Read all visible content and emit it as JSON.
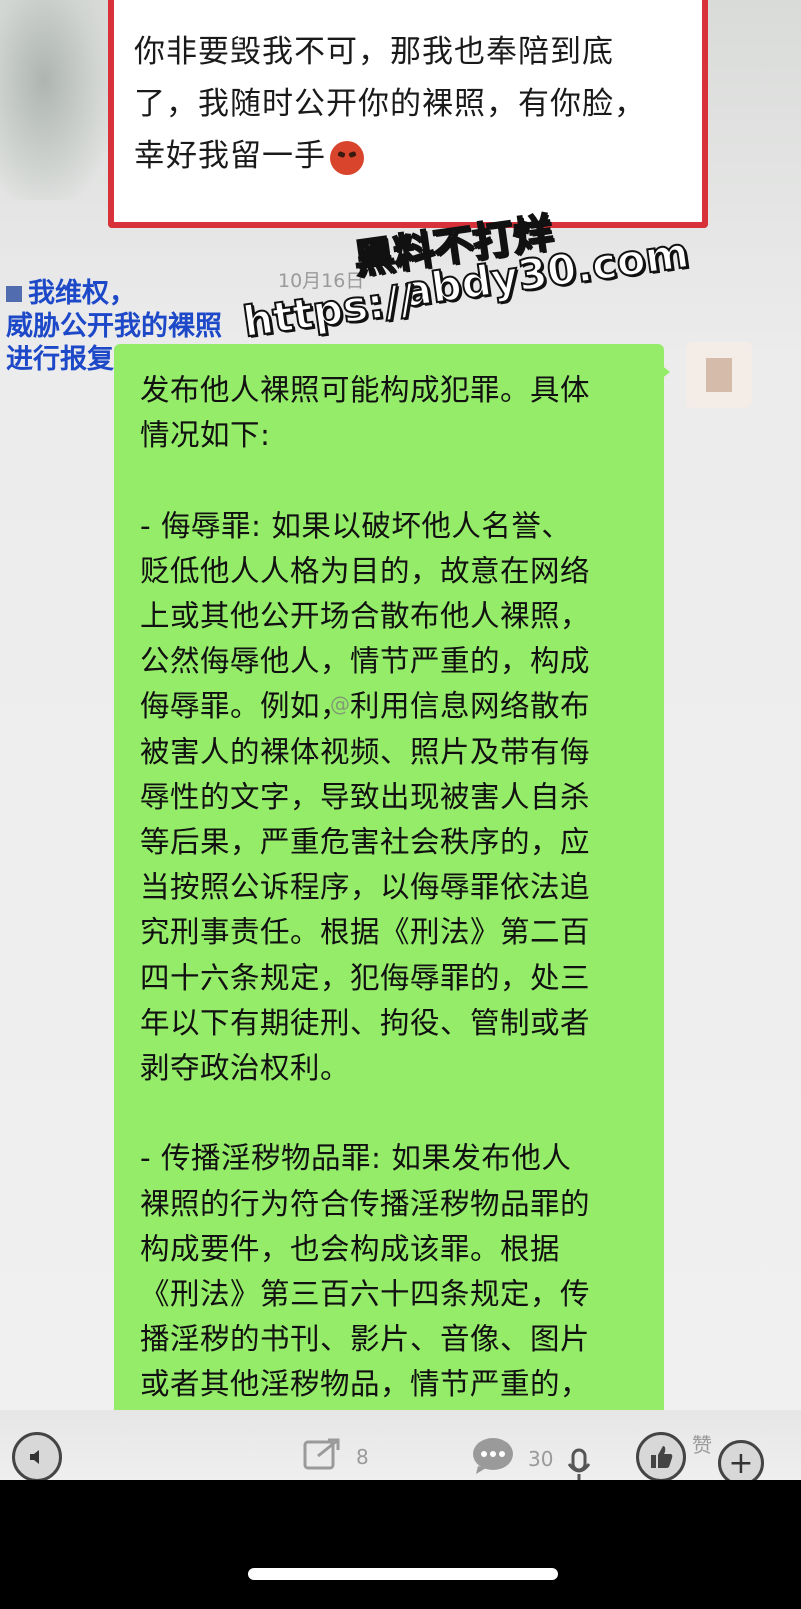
{
  "quoted_message": {
    "text": "你非要毁我不可，那我也奉陪到底了，我随时公开你的裸照，有你脸，幸好我留一手"
  },
  "caption": {
    "text": "我维权，\n威胁公开我的裸照\n进行报复"
  },
  "timestamp": "10月16日",
  "watermark": {
    "line1": "黑料不打烊",
    "line2": "abdy30.com",
    "line3": "https://"
  },
  "weibo_mark": "@",
  "reply_message": {
    "text": "发布他人裸照可能构成犯罪。具体\n情况如下:\n\n- 侮辱罪: 如果以破坏他人名誉、\n贬低他人人格为目的，故意在网络\n上或其他公开场合散布他人裸照，\n公然侮辱他人，情节严重的，构成\n侮辱罪。例如，利用信息网络散布\n被害人的裸体视频、照片及带有侮\n辱性的文字，导致出现被害人自杀\n等后果，严重危害社会秩序的，应\n当按照公诉程序，以侮辱罪依法追\n究刑事责任。根据《刑法》第二百\n四十六条规定，犯侮辱罪的，处三\n年以下有期徒刑、拘役、管制或者\n剥夺政治权利。\n\n- 传播淫秽物品罪: 如果发布他人\n裸照的行为符合传播淫秽物品罪的\n构成要件，也会构成该罪。根据\n《刑法》第三百六十四条规定，传\n播淫秽的书刊、影片、音像、图片\n或者其他淫秽物品，情节严重的，"
  },
  "bottom_bar": {
    "share_count": "8",
    "comment_count": "30",
    "like_label": "赞"
  },
  "icons": {
    "share": "share-icon",
    "comment": "comment-icon",
    "mic": "mic-icon",
    "like": "thumb-up-icon",
    "add": "plus-icon",
    "voice": "voice-icon"
  }
}
